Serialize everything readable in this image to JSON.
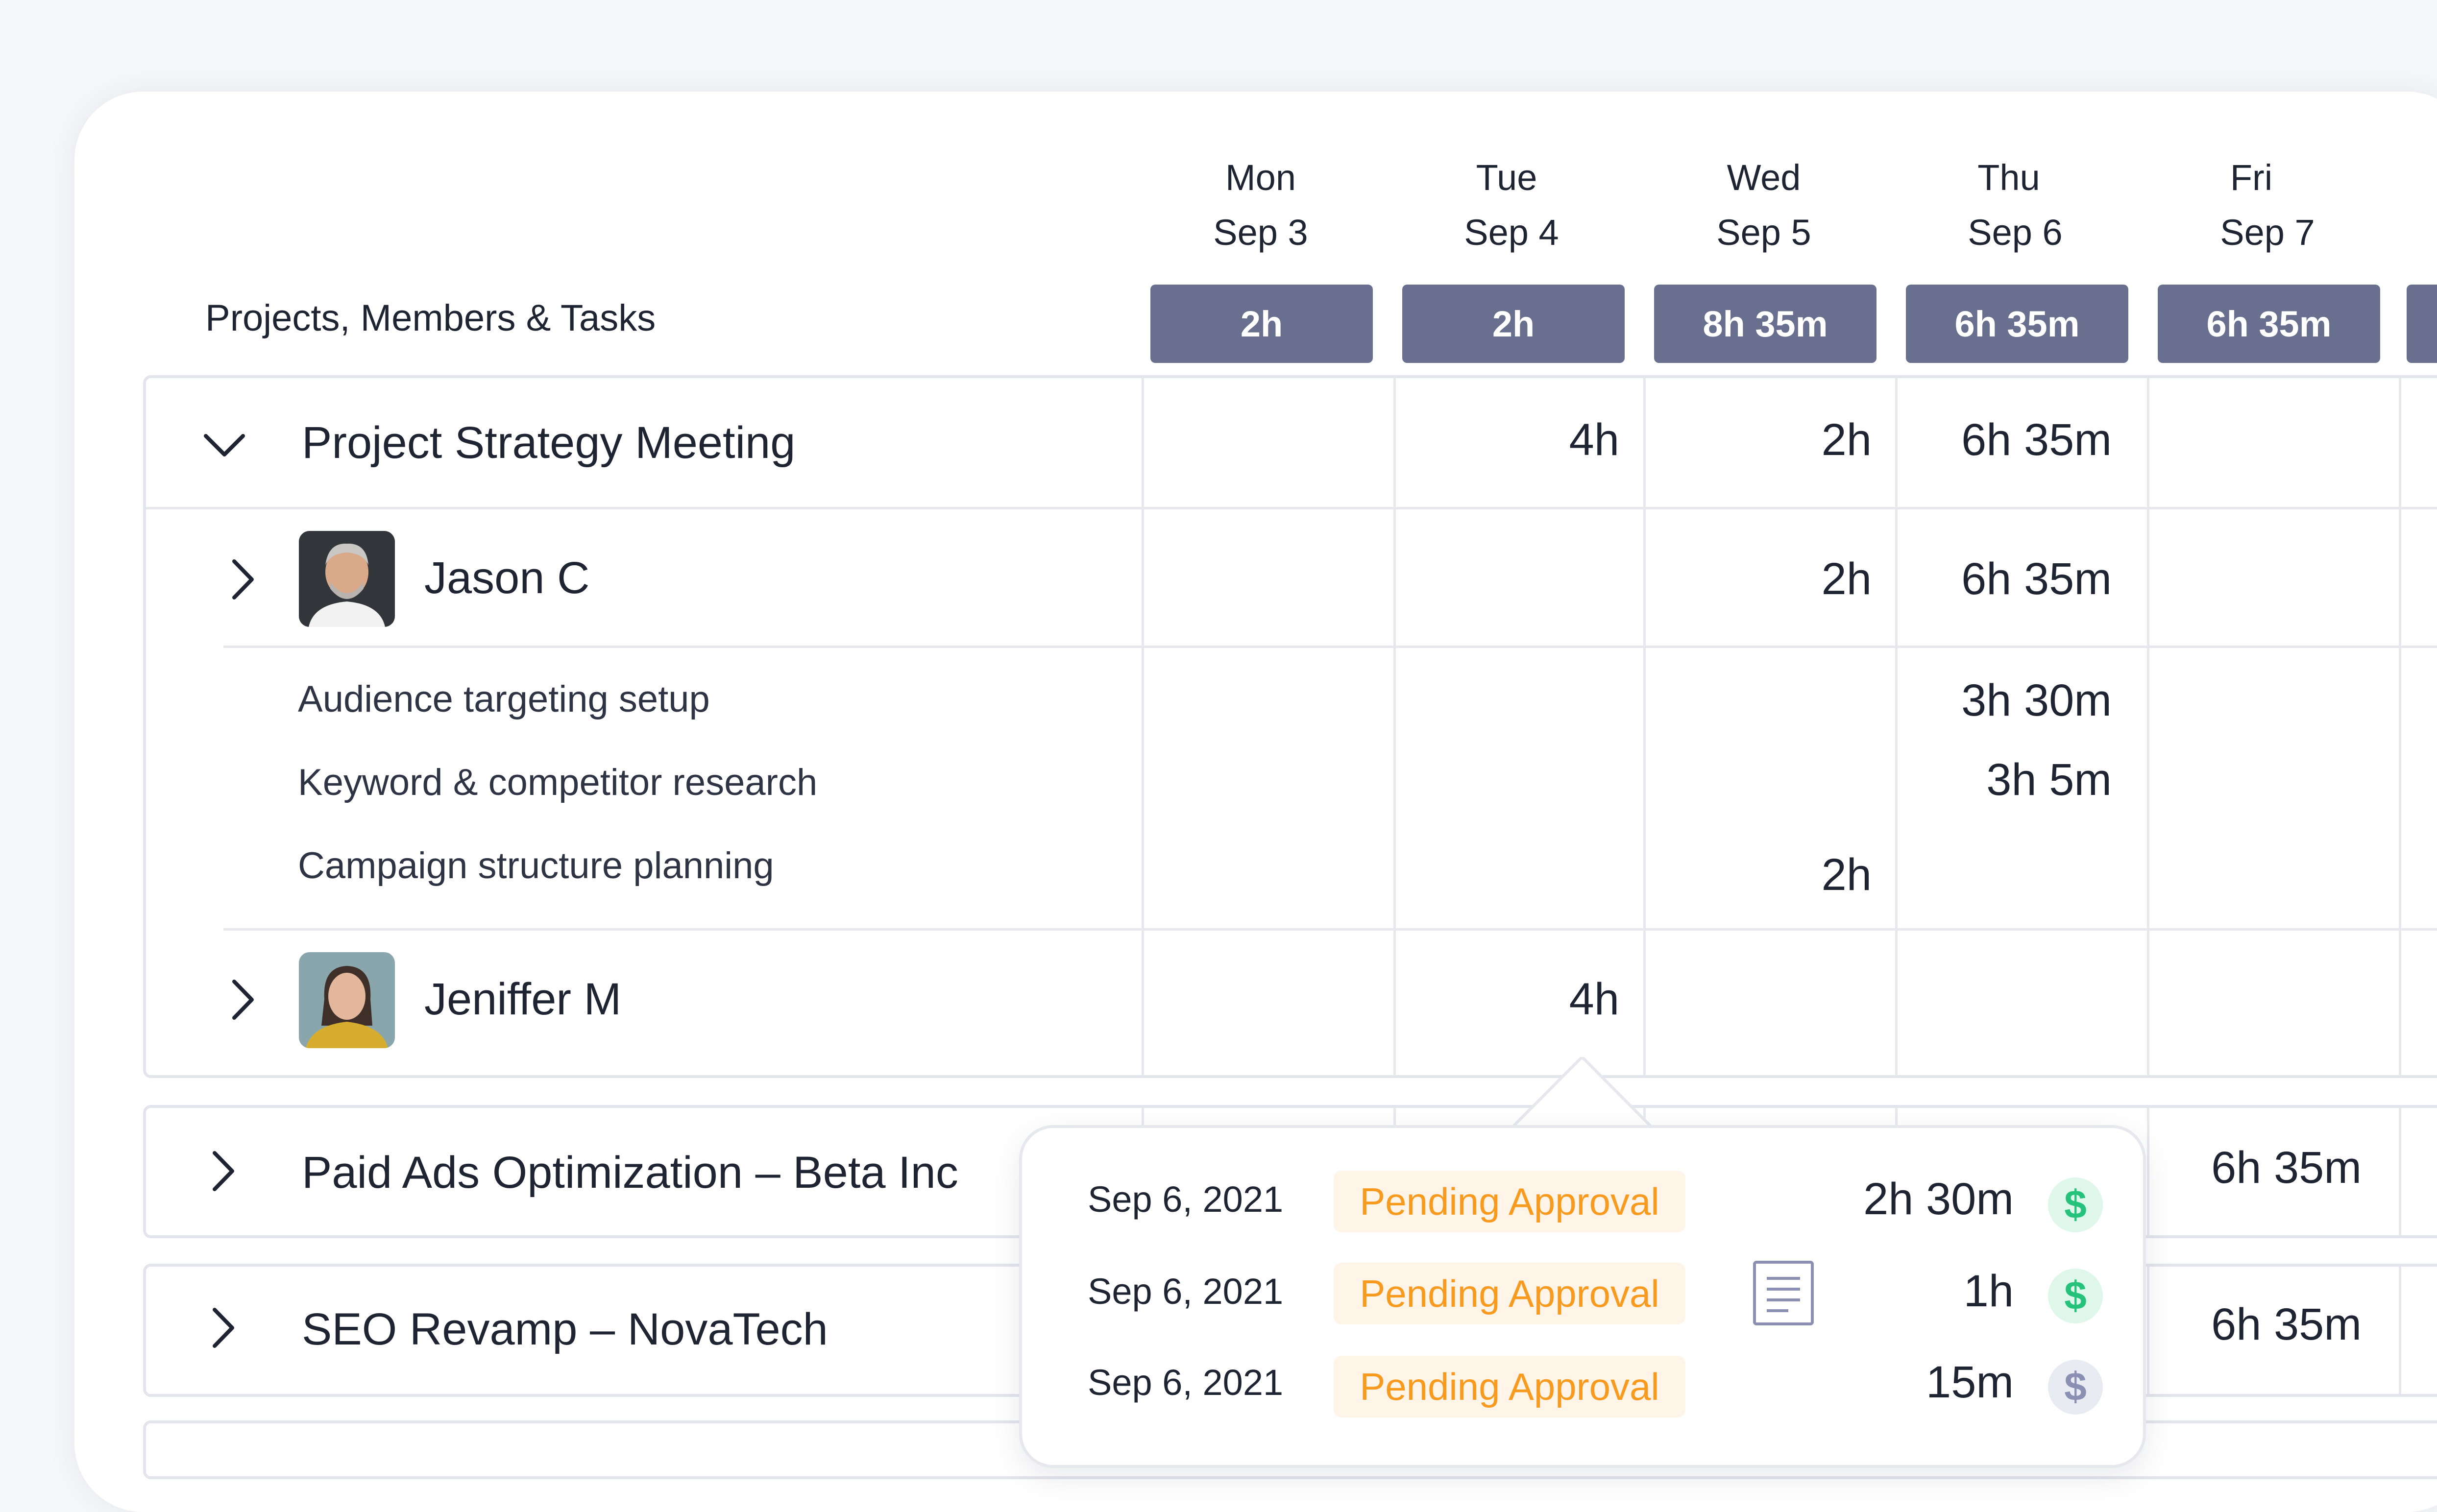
{
  "header": {
    "column_label": "Projects, Members & Tasks",
    "days": [
      {
        "name": "Mon",
        "date": "Sep 3",
        "total": "2h"
      },
      {
        "name": "Tue",
        "date": "Sep 4",
        "total": "2h"
      },
      {
        "name": "Wed",
        "date": "Sep 5",
        "total": "8h 35m"
      },
      {
        "name": "Thu",
        "date": "Sep 6",
        "total": "6h 35m"
      },
      {
        "name": "Fri",
        "date": "Sep 7",
        "total": "6h 35m"
      }
    ]
  },
  "projects": [
    {
      "title": "Project Strategy Meeting",
      "expanded": true,
      "cells": {
        "tue": "4h",
        "wed": "2h",
        "thu": "6h 35m"
      },
      "members": [
        {
          "name": "Jason C",
          "cells": {
            "wed": "2h",
            "thu": "6h 35m"
          },
          "tasks": [
            {
              "name": "Audience targeting setup",
              "thu": "3h 30m"
            },
            {
              "name": "Keyword & competitor research",
              "thu": "3h 5m"
            },
            {
              "name": "Campaign structure planning",
              "wed": "2h"
            }
          ]
        },
        {
          "name": "Jeniffer M",
          "cells": {
            "tue": "4h"
          }
        }
      ]
    },
    {
      "title": "Paid Ads Optimization – Beta Inc",
      "expanded": false,
      "cells": {
        "fri": "6h 35m"
      }
    },
    {
      "title": "SEO Revamp – NovaTech",
      "expanded": false,
      "cells": {
        "fri": "6h 35m"
      }
    }
  ],
  "popover": {
    "entries": [
      {
        "date": "Sep 6, 2021",
        "status": "Pending Approval",
        "duration": "2h 30m",
        "billable": true
      },
      {
        "date": "Sep 6, 2021",
        "status": "Pending Approval",
        "duration": "1h",
        "billable": true,
        "has_note": true
      },
      {
        "date": "Sep 6, 2021",
        "status": "Pending Approval",
        "duration": "15m",
        "billable": false
      }
    ],
    "dollar_symbol": "$"
  }
}
